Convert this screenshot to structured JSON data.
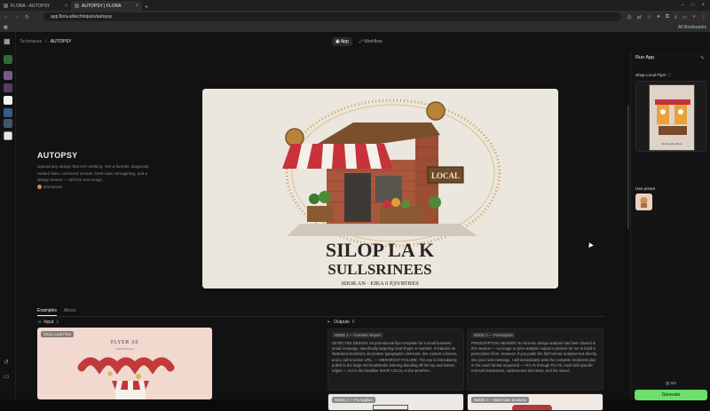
{
  "browser": {
    "tabs": [
      {
        "label": "FLORA - AUTOPSY"
      },
      {
        "label": "AUTOPSY | FLORA"
      }
    ],
    "new_tab": "+",
    "url": "app.flora.ai/techniques/autopsy",
    "bookmarks_label": "All Bookmarks"
  },
  "breadcrumb": {
    "parent": "Techniques",
    "separator": "/",
    "current": "AUTOPSY"
  },
  "modes": [
    {
      "label": "App"
    },
    {
      "label": "Workflow"
    }
  ],
  "hero": {
    "title": "AUTOPSY",
    "description": "Upload any design that isn't working. Get a forensic diagnosis, ranked fixes, corrected version, best-case reimagining, and a design lesson — all from one image.",
    "author": "Dai Moore",
    "image": {
      "headline": "SILOP LA K",
      "subheadline": "SULLSRINEES",
      "tagline": "SIIOR AN · EIKA 0 P,SVRTRES",
      "sign": "LOCAL",
      "colors": {
        "awning_red": "#c8323a",
        "brick": "#a9573c",
        "wood": "#7a4f2e",
        "gold": "#c9a24a",
        "bg": "#e9e4dc"
      }
    }
  },
  "tabs": [
    {
      "label": "Examples"
    },
    {
      "label": "About"
    }
  ],
  "input_section": {
    "label": "Input",
    "count": "1",
    "card": {
      "tag": "Shop Local Flyer",
      "title": "FLYER AS",
      "subtitle": "Small Business"
    }
  },
  "outputs_section": {
    "label": "Outputs",
    "count": "8",
    "cards": [
      {
        "tag": "NODE 1 — Forensic Report",
        "text": "DETECTED DESIGN: A5 promotional flyer template for a small business email campaign, specifically targeting local shops or markets. It features an illustrated storefront, decorative typographic elements, two content columns, and a call-to-action URL. — HIERARCHY FAILURE: The eye is immediately pulled to the large red brushstroke lettering bleeding off the top and bottom edges — not to the headline SHOP LOCAL or the storefron..."
      },
      {
        "tag": "NODE 2 — Prescription",
        "text": "PRESCRIPTION HEADER: No forensic design analysis has been shared in this session — no image or prior analysis output is present for me to build a prescription from. However, if you paste the full forensic analysis text directly into your next message, I will immediately write the complete treatment plan in the exact format requested — FIX #1 through FIX #5, each with specific removal instructions, replacement directives, and the visual..."
      },
      {
        "tag": "NODE 3 — Fix Applied",
        "text": ""
      },
      {
        "tag": "NODE 4 — Best Case Scenario",
        "text": ""
      }
    ]
  },
  "right_panel": {
    "title": "Run App",
    "input_label": "Shop Local Flyer",
    "flyer_caption": "Be Proudly Here",
    "preset_label": "Use preset",
    "count_label": "8/8",
    "generate_label": "Generate"
  }
}
